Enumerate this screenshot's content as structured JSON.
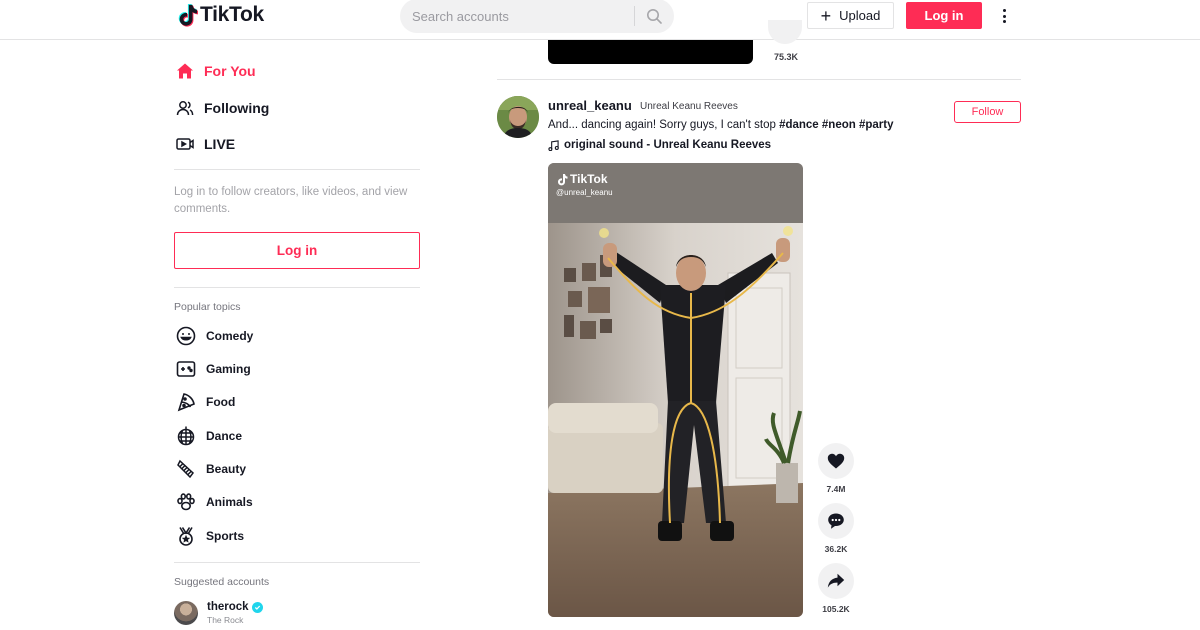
{
  "header": {
    "logo_text": "TikTok",
    "search_placeholder": "Search accounts",
    "upload_label": "Upload",
    "login_label": "Log in"
  },
  "sidebar": {
    "nav": [
      {
        "label": "For You",
        "icon": "home-icon",
        "active": true
      },
      {
        "label": "Following",
        "icon": "people-icon",
        "active": false
      },
      {
        "label": "LIVE",
        "icon": "live-icon",
        "active": false
      }
    ],
    "login_prompt": "Log in to follow creators, like videos, and view comments.",
    "login_label": "Log in",
    "popular_topics_title": "Popular topics",
    "topics": [
      {
        "label": "Comedy",
        "icon": "smile-icon"
      },
      {
        "label": "Gaming",
        "icon": "gamepad-icon"
      },
      {
        "label": "Food",
        "icon": "pizza-icon"
      },
      {
        "label": "Dance",
        "icon": "disco-ball-icon"
      },
      {
        "label": "Beauty",
        "icon": "comb-icon"
      },
      {
        "label": "Animals",
        "icon": "paw-icon"
      },
      {
        "label": "Sports",
        "icon": "medal-icon"
      }
    ],
    "suggested_title": "Suggested accounts",
    "suggested": [
      {
        "username": "therock",
        "nickname": "The Rock",
        "verified": true
      }
    ]
  },
  "feed": {
    "previous_post": {
      "share_count": "75.3K"
    },
    "post": {
      "username": "unreal_keanu",
      "nickname": "Unreal Keanu Reeves",
      "caption_text": "And... dancing again! Sorry guys, I can't stop ",
      "hashtags": [
        "#dance",
        "#neon",
        "#party"
      ],
      "sound": "original sound - Unreal Keanu Reeves",
      "follow_label": "Follow",
      "watermark_logo": "TikTok",
      "watermark_handle": "@unreal_keanu",
      "likes": "7.4M",
      "comments": "36.2K",
      "shares": "105.2K"
    }
  },
  "colors": {
    "accent": "#fe2c55",
    "text": "#161823",
    "muted": "#a3a3a8",
    "verified": "#20d5ec"
  }
}
